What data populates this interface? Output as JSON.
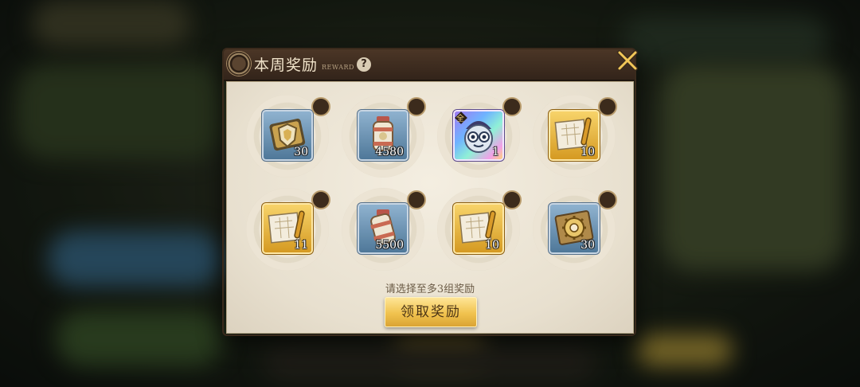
{
  "modal": {
    "title": "本周奖励",
    "subtitle": "REWARD",
    "help_icon": "question-icon",
    "close_icon": "close-icon",
    "hint": "请选择至多3组奖励",
    "claim_label": "领取奖励"
  },
  "rewards": [
    {
      "icon": "shield-emblem-icon",
      "rarity": "blue",
      "qty": "30",
      "selected": false
    },
    {
      "icon": "potion-vial-icon",
      "rarity": "blue",
      "qty": "4580",
      "selected": false
    },
    {
      "icon": "character-face-icon",
      "rarity": "rainbow",
      "qty": "1",
      "badge": "全",
      "selected": false
    },
    {
      "icon": "blueprint-scroll-icon",
      "rarity": "gold",
      "qty": "10",
      "selected": false
    },
    {
      "icon": "blueprint-scroll-icon",
      "rarity": "gold",
      "qty": "11",
      "selected": false
    },
    {
      "icon": "potion-vial-icon",
      "rarity": "blue",
      "qty": "5500",
      "selected": false
    },
    {
      "icon": "blueprint-scroll-icon",
      "rarity": "gold",
      "qty": "10",
      "selected": false
    },
    {
      "icon": "gear-book-icon",
      "rarity": "blue",
      "qty": "30",
      "selected": false
    }
  ],
  "colors": {
    "header": "#3f2d20",
    "panel": "#efe8d9",
    "button": "#f0c24e",
    "gold_tile": "#e2ad38",
    "blue_tile": "#6e93b4"
  }
}
